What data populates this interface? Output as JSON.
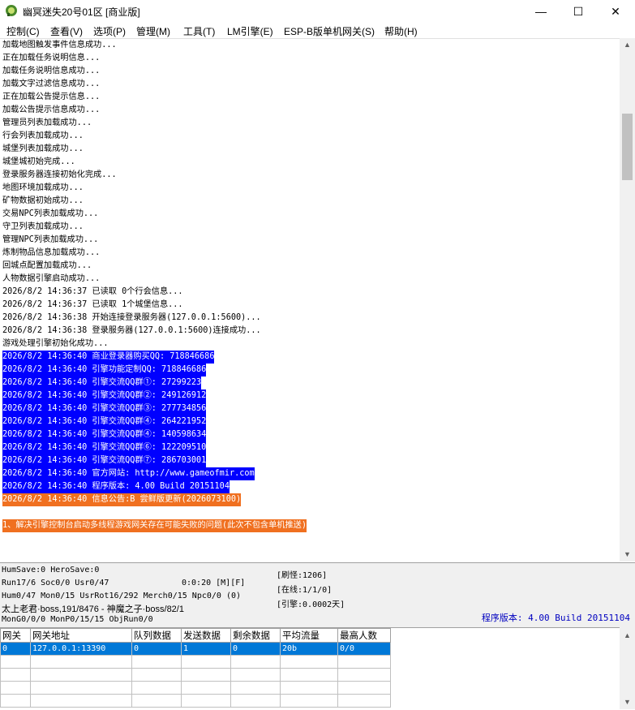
{
  "window": {
    "title": "幽冥迷失20号01区 [商业版]",
    "minimize": "—",
    "maximize": "☐",
    "close": "✕"
  },
  "menu": [
    "控制(C)",
    "查看(V)",
    "选项(P)",
    "管理(M)",
    "工具(T)",
    "LM引擎(E)",
    "ESP-B版单机网关(S)",
    "帮助(H)"
  ],
  "log": [
    {
      "text": "加载地图触发事件信息成功...",
      "style": "normal"
    },
    {
      "text": "正在加载任务说明信息...",
      "style": "normal"
    },
    {
      "text": "加载任务说明信息成功...",
      "style": "normal"
    },
    {
      "text": "加载文字过滤信息成功...",
      "style": "normal"
    },
    {
      "text": "正在加载公告提示信息...",
      "style": "normal"
    },
    {
      "text": "加载公告提示信息成功...",
      "style": "normal"
    },
    {
      "text": "管理员列表加载成功...",
      "style": "normal"
    },
    {
      "text": "行会列表加载成功...",
      "style": "normal"
    },
    {
      "text": "城堡列表加载成功...",
      "style": "normal"
    },
    {
      "text": "城堡城初始完成...",
      "style": "normal"
    },
    {
      "text": "登录服务器连接初始化完成...",
      "style": "normal"
    },
    {
      "text": "地图环境加载成功...",
      "style": "normal"
    },
    {
      "text": "矿物数据初始成功...",
      "style": "normal"
    },
    {
      "text": "交易NPC列表加载成功...",
      "style": "normal"
    },
    {
      "text": "守卫列表加载成功...",
      "style": "normal"
    },
    {
      "text": "管理NPC列表加载成功...",
      "style": "normal"
    },
    {
      "text": "炼制物品信息加载成功...",
      "style": "normal"
    },
    {
      "text": "回城点配置加载成功...",
      "style": "normal"
    },
    {
      "text": "人物数据引擎启动成功...",
      "style": "normal"
    },
    {
      "text": "2026/8/2 14:36:37 已读取 0个行会信息...",
      "style": "normal"
    },
    {
      "text": "2026/8/2 14:36:37 已读取 1个城堡信息...",
      "style": "normal"
    },
    {
      "text": "2026/8/2 14:36:38 开始连接登录服务器(127.0.0.1:5600)...",
      "style": "normal"
    },
    {
      "text": "2026/8/2 14:36:38 登录服务器(127.0.0.1:5600)连接成功...",
      "style": "normal"
    },
    {
      "text": "游戏处理引擎初始化成功...",
      "style": "normal"
    },
    {
      "text": "2026/8/2 14:36:40 商业登录器购买QQ: 718846686",
      "style": "sel"
    },
    {
      "text": "2026/8/2 14:36:40 引擎功能定制QQ: 718846686",
      "style": "sel"
    },
    {
      "text": "2026/8/2 14:36:40 引擎交流QQ群①: 27299223",
      "style": "sel"
    },
    {
      "text": "2026/8/2 14:36:40 引擎交流QQ群②: 249126912",
      "style": "sel"
    },
    {
      "text": "2026/8/2 14:36:40 引擎交流QQ群③: 277734856",
      "style": "sel"
    },
    {
      "text": "2026/8/2 14:36:40 引擎交流QQ群④: 264221952",
      "style": "sel"
    },
    {
      "text": "2026/8/2 14:36:40 引擎交流QQ群④: 140598634",
      "style": "sel"
    },
    {
      "text": "2026/8/2 14:36:40 引擎交流QQ群⑥: 122209510",
      "style": "sel"
    },
    {
      "text": "2026/8/2 14:36:40 引擎交流QQ群⑦: 286703001",
      "style": "sel"
    },
    {
      "text": "2026/8/2 14:36:40 官方网站: http://www.gameofmir.com",
      "style": "sel"
    },
    {
      "text": "2026/8/2 14:36:40 程序版本: 4.00 Build 20151104",
      "style": "sel"
    },
    {
      "text": "2026/8/2 14:36:40 信息公告:B 尝鲜版更新(2026073100)",
      "style": "orange"
    },
    {
      "text": "",
      "style": "normal"
    },
    {
      "text": "1、解决引擎控制台启动多线程游戏网关存在可能失败的问题(此次不包含单机推送)",
      "style": "orange"
    }
  ],
  "status": {
    "line1": "HumSave:0 HeroSave:0",
    "line2a": "Run17/6 Soc0/0 Usr0/47",
    "line2b": "0:0:20 [M][F]",
    "line3": "Hum0/47 Mon0/15 UsrRot16/292 Merch0/15 Npc0/0 (0)",
    "line4": "太上老君·boss,191/8476 - 神魔之子·boss/82/1",
    "line5": "MonG0/0/0 MonP0/15/15 ObjRun0/0",
    "refresh": "[刷怪:1206]",
    "online": "[在线:1/1/0]",
    "engine": "[引擎:0.0002天]",
    "version": "程序版本: 4.00 Build 20151104"
  },
  "gateway": {
    "headers": [
      "网关",
      "网关地址",
      "队列数据",
      "发送数据",
      "剩余数据",
      "平均流量",
      "最高人数"
    ],
    "rows": [
      [
        "0",
        "127.0.0.1:13390",
        "0",
        "1",
        "0",
        "20b",
        "0/0"
      ]
    ]
  }
}
